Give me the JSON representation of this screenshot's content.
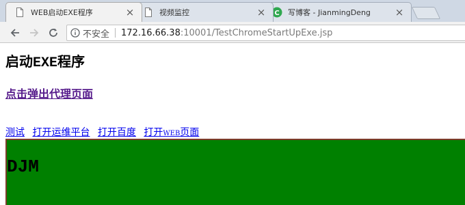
{
  "tabs": [
    {
      "title": "WEB启动EXE程序",
      "close": "×",
      "active": true
    },
    {
      "title": "视频监控",
      "close": "×",
      "active": false
    },
    {
      "title": "写博客 - JianmingDeng",
      "close": "×",
      "active": false
    }
  ],
  "toolbar": {
    "security_text": "不安全",
    "url_host": "172.16.66.38",
    "url_path": ":10001/TestChromeStartUpExe.jsp"
  },
  "page": {
    "title_prefix": "启动",
    "title_exe": "EXE",
    "title_suffix": "程序",
    "popup_link": "点击弹出代理页面",
    "links": {
      "test": "测试",
      "ops_platform": "打开运维平台",
      "baidu": "打开百度",
      "web_prefix": "打开",
      "web_caps": "WEB",
      "web_suffix": "页面"
    },
    "block_text": "DJM",
    "block_color": "#008000"
  },
  "icons": {
    "tab1": "page-icon",
    "tab2": "page-icon",
    "tab3": "csdn-icon",
    "back": "back-arrow-icon",
    "forward": "forward-arrow-icon",
    "reload": "reload-icon",
    "info": "info-icon"
  }
}
